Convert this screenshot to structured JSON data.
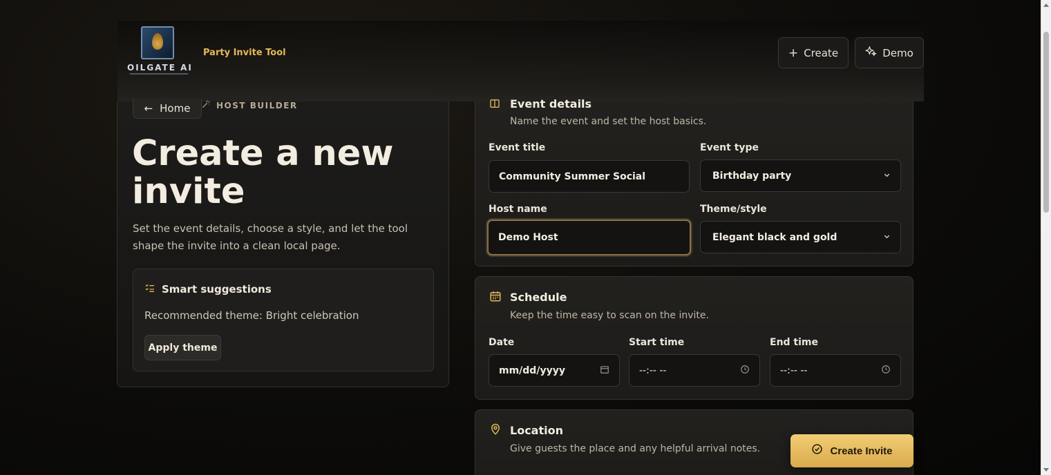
{
  "header": {
    "logo_text": "OILGATE AI",
    "app_title": "Party Invite Tool",
    "create_label": "Create",
    "demo_label": "Demo"
  },
  "left": {
    "home_label": "Home",
    "builder_tag": "HOST BUILDER",
    "hero_title": "Create a new invite",
    "hero_desc": "Set the event details, choose a style, and let the tool shape the invite into a clean local page.",
    "suggestions": {
      "title": "Smart suggestions",
      "text": "Recommended theme: Bright celebration",
      "apply_label": "Apply theme"
    }
  },
  "event_details": {
    "title": "Event details",
    "subtitle": "Name the event and set the host basics.",
    "event_title_label": "Event title",
    "event_title_value": "Community Summer Social",
    "event_type_label": "Event type",
    "event_type_value": "Birthday party",
    "host_name_label": "Host name",
    "host_name_value": "Demo Host",
    "theme_label": "Theme/style",
    "theme_value": "Elegant black and gold"
  },
  "schedule": {
    "title": "Schedule",
    "subtitle": "Keep the time easy to scan on the invite.",
    "date_label": "Date",
    "date_value": "mm/dd/yyyy",
    "start_label": "Start time",
    "start_value": "--:-- --",
    "end_label": "End time",
    "end_value": "--:-- --"
  },
  "location": {
    "title": "Location",
    "subtitle": "Give guests the place and any helpful arrival notes."
  },
  "create_invite_label": "Create Invite",
  "colors": {
    "accent_gold": "#e3b957",
    "button_gold": "#f2cd74",
    "background": "#0b0a08"
  }
}
